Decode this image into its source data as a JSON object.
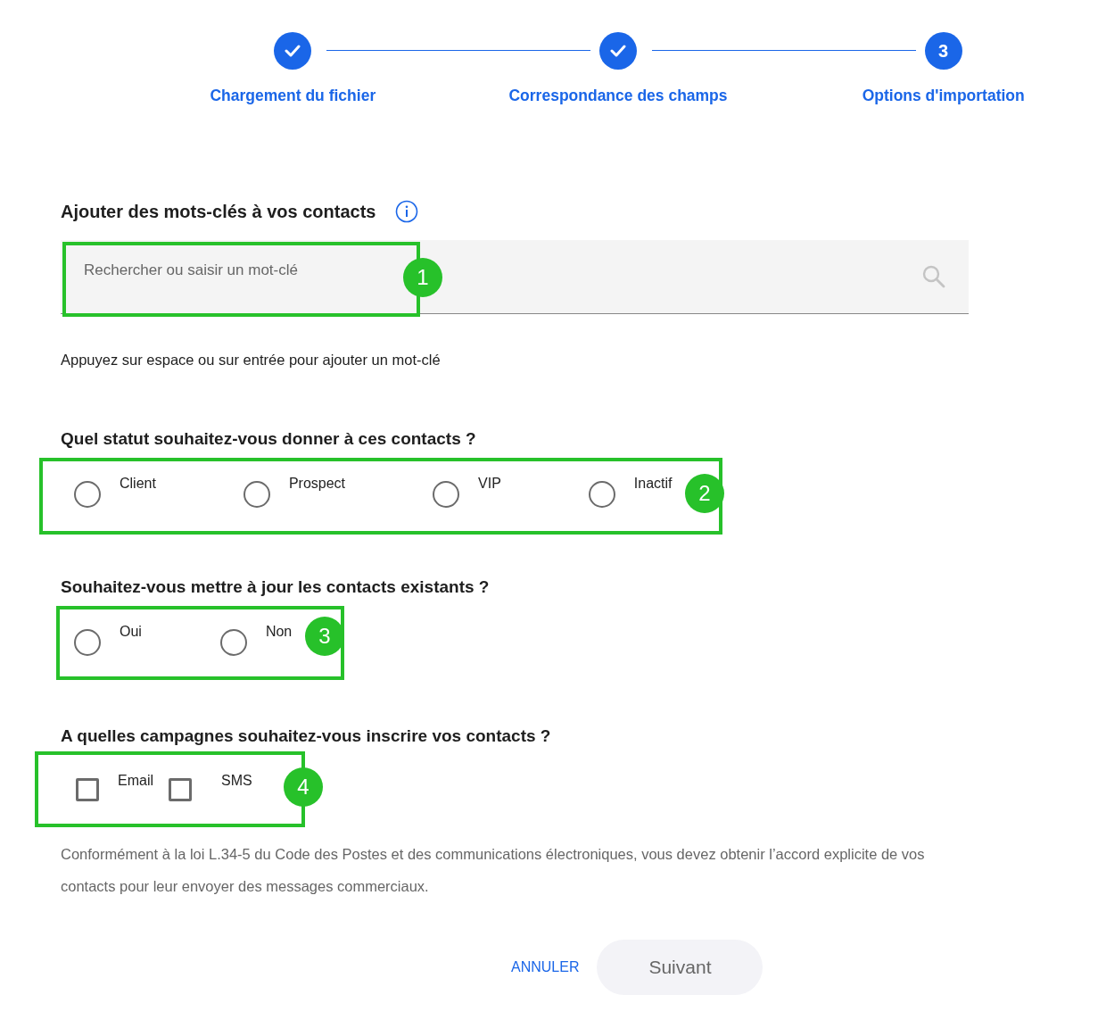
{
  "stepper": {
    "steps": [
      {
        "label": "Chargement du fichier",
        "completed": true
      },
      {
        "label": "Correspondance des champs",
        "completed": true
      },
      {
        "label": "Options d'importation",
        "completed": false,
        "number": "3"
      }
    ]
  },
  "keywords": {
    "title": "Ajouter des mots-clés à vos contacts",
    "field": {
      "placeholder": "Rechercher ou saisir un mot-clé"
    },
    "hint": "Appuyez sur espace ou sur entrée pour ajouter un mot-clé",
    "callout": "1"
  },
  "status": {
    "question": "Quel statut souhaitez-vous donner à ces contacts ?",
    "callout": "2",
    "options": [
      {
        "label": "Client",
        "selected": false
      },
      {
        "label": "Prospect",
        "selected": false
      },
      {
        "label": "VIP",
        "selected": false
      },
      {
        "label": "Inactif",
        "selected": false
      }
    ]
  },
  "update": {
    "question": "Souhaitez-vous mettre à jour les contacts existants ?",
    "callout": "3",
    "options": [
      {
        "label": "Oui",
        "selected": false
      },
      {
        "label": "Non",
        "selected": false
      }
    ]
  },
  "campaigns": {
    "question": "A quelles campagnes souhaitez-vous inscrire vos contacts ?",
    "callout": "4",
    "options": [
      {
        "label": "Email",
        "checked": false
      },
      {
        "label": "SMS",
        "checked": false
      }
    ],
    "notice": "Conformément à la loi L.34-5 du Code des Postes et des communications électroniques, vous devez obtenir l’accord explicite de vos contacts pour leur envoyer des messages commerciaux."
  },
  "actions": {
    "cancel": "ANNULER",
    "next": {
      "label": "Suivant",
      "disabled": true
    }
  }
}
